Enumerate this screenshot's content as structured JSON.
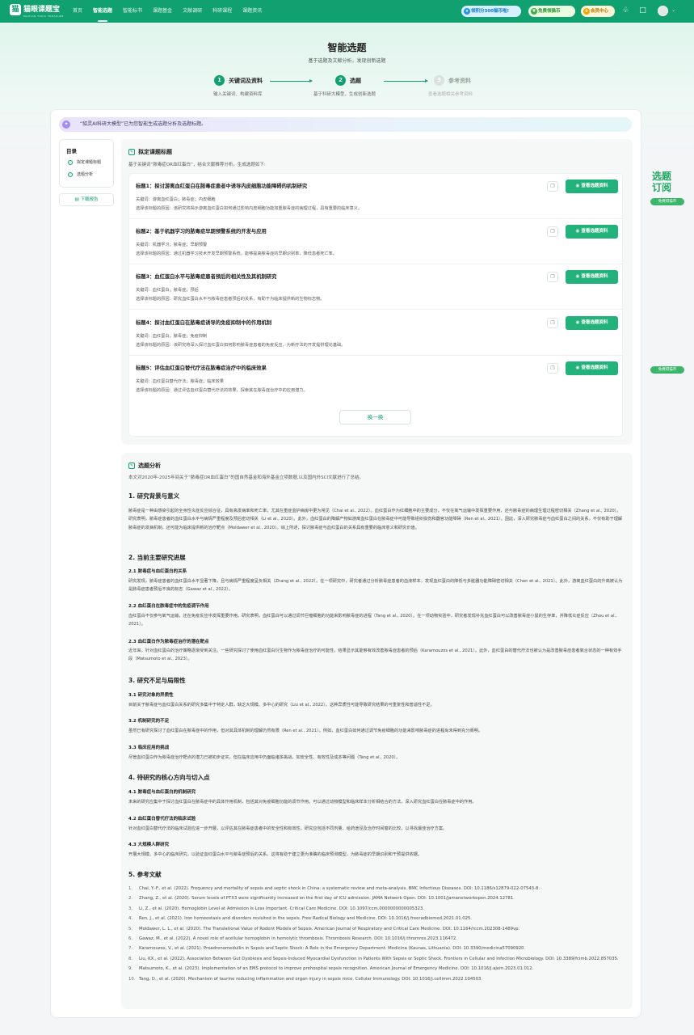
{
  "nav": {
    "logo_text": "猫眼课题宝",
    "logo_sub": "MAOYAN TOPIC TREASURE",
    "menu": [
      "首页",
      "智能选题",
      "智能标书",
      "课题基金",
      "文献调研",
      "科研课程",
      "课题资讯"
    ],
    "active_index": 1,
    "promo_blue": "领积分300猫币啦!",
    "promo_green": "免费领猫币",
    "vip": "会员中心"
  },
  "hero": {
    "title": "智能选题",
    "subtitle": "基于选题及文献分析，发现创新选题"
  },
  "steps": [
    {
      "num": "1",
      "label": "关键词及资料",
      "desc": "输入关键词、构建资料库"
    },
    {
      "num": "2",
      "label": "选题",
      "desc": "基于科研大模型，生成创新选题"
    },
    {
      "num": "3",
      "label": "参考资料",
      "desc": "查看选题相关参考资料"
    }
  ],
  "banner": "“貂灵AI科研大模型”已为您智能生成选题分析及选题标题。",
  "toc": {
    "title": "目录",
    "items": [
      "拟定课题标题",
      "选题分析"
    ],
    "download": "下载报告"
  },
  "titles_section": {
    "title": "拟定课题标题",
    "subtitle": "基于关键词“脓毒症OR血红蛋白”，结合文献推荐分析，生成选题如下:",
    "view_label": "查看选题资料",
    "swap_label": "换一换",
    "items": [
      {
        "title": "标题1：探讨游离血红蛋白在脓毒症患者中诱导内皮细胞功能障碍的机制研究",
        "keywords": "关键词：游离血红蛋白；脓毒症；内皮细胞",
        "reason": "选择该标题的原因：该研究将揭示游离血红蛋白如何通过影响内皮细胞功能加重脓毒症的病理过程，具有重要的临床意义。"
      },
      {
        "title": "标题2：基于机器学习的脓毒症早期预警系统的开发与应用",
        "keywords": "关键词：机器学习；脓毒症；早期预警",
        "reason": "选择该标题的原因：通过机器学习技术开发早期预警系统，能够提高脓毒症的早期识别率，降低患者死亡率。"
      },
      {
        "title": "标题3：血红蛋白水平与脓毒症患者预后的相关性及其机制研究",
        "keywords": "关键词：血红蛋白；脓毒症；预后",
        "reason": "选择该标题的原因：研究血红蛋白水平与脓毒症患者预后的关系，有助于为临床提供新的生物标志物。"
      },
      {
        "title": "标题4：探讨血红蛋白在脓毒症诱导的免疫抑制中的作用机制",
        "keywords": "关键词：血红蛋白；脓毒症；免疫抑制",
        "reason": "选择该标题的原因：该研究将深入探讨血红蛋白如何影响脓毒症患者的免疫反应，为新疗法的开发提供理论基础。"
      },
      {
        "title": "标题5：评估血红蛋白替代疗法在脓毒症治疗中的临床效果",
        "keywords": "关键词：血红蛋白替代疗法；脓毒症；临床效果",
        "reason": "选择该标题的原因：通过评估血红蛋白替代疗法的效果，探索其在脓毒症治疗中的应用潜力。"
      }
    ]
  },
  "float": {
    "title_line1": "选题",
    "title_line2": "订阅",
    "pill1": "免费得猫币",
    "pill2": "免费得猫币"
  },
  "analysis": {
    "title": "选题分析",
    "intro": "本文对2020年-2025年间关于“脓毒症OR血红蛋白”的国自然基金和海外基金立项数据,以及国内外SCI文献进行了总结。",
    "s1": {
      "title": "1. 研究背景与意义",
      "para": "脓毒症是一种由感染引起的全身性炎症反应综合征，具有高发病率和死亡率，尤其在重症监护病房中更为常见（Chai et al., 2022）。血红蛋白作为红细胞中的主要成分，不仅在氧气运输中发挥重要作用，还与脓毒症的病理生理过程密切相关（Zhang et al., 2020）。研究表明，脓毒症患者的血红蛋白水平与病情严重程度及预后密切相关（Li et al., 2020）。此外，血红蛋白的降解产物如游离血红蛋白在脓毒症中可能导致组织损伤和器官功能障碍（Ren et al., 2021）。因此，深入研究脓毒症与血红蛋白之间的关系，不仅有助于理解脓毒症的发病机制，还可能为临床提供新的治疗靶点（Moldawer et al., 2020）。综上所述，探讨脓毒症与血红蛋白的关系具有重要的临床意义和研究价值。"
    },
    "s2": {
      "title": "2. 当前主要研究进展",
      "sub1_title": "2.1 脓毒症与血红蛋白的关系",
      "sub1_para": "研究发现，脓毒症患者的血红蛋白水平显著下降，且与病情严重程度呈负相关（Zhang et al., 2022）。在一项研究中，研究者通过分析脓毒症患者的血液样本，发现血红蛋白的降低与多脏器功能障碍密切相关（Chen et al., 2021）。此外，游离血红蛋白的升高被认为是脓毒症患者预后不良的标志（Gawaz et al., 2022）。",
      "sub2_title": "2.2 血红蛋白在脓毒症中的免疫调节作用",
      "sub2_para": "血红蛋白不仅参与氧气运输，还在免疫反应中发挥重要作用。研究表明，血红蛋白可以通过调节巨噬细胞的功能来影响脓毒症的进程（Tang et al., 2020）。在一项动物实验中，研究者发现补充血红蛋白可以改善脓毒症小鼠的生存率，并降低炎症反应（Zhou et al., 2021）。",
      "sub3_title": "2.3 血红蛋白作为脓毒症治疗的潜在靶点",
      "sub3_para": "近年来，针对血红蛋白的治疗策略逐渐受到关注。一些研究探讨了使用血红蛋白衍生物作为脓毒症治疗的可能性，结果显示其能够有效改善脓毒症患者的预后（Karamouzos et al., 2021）。此外，血红蛋白的替代疗法也被认为是改善脓毒症患者氧合状态的一种有效手段（Matsumoto et al., 2023）。"
    },
    "s3": {
      "title": "3. 研究不足与局限性",
      "sub1_title": "3.1 研究对象的异质性",
      "sub1_para": "目前关于脓毒症与血红蛋白关系的研究多集中于特定人群，缺乏大规模、多中心的研究（Liu et al., 2022）。这种异质性可能导致研究结果的可重复性和普适性不足。",
      "sub2_title": "3.2 机制研究的不足",
      "sub2_para": "虽然已有研究探讨了血红蛋白在脓毒症中的作用，但对其具体机制的理解仍然有限（Ren et al., 2021）。例如，血红蛋白如何通过调节免疫细胞的功能来影响脓毒症的进程尚未得到充分阐明。",
      "sub3_title": "3.3 临床应用的挑战",
      "sub3_para": "尽管血红蛋白作为脓毒症治疗靶点的潜力已被初步证实，但在临床应用中仍面临诸多挑战，如安全性、有效性及成本等问题（Tang et al., 2020）。"
    },
    "s4": {
      "title": "4. 待研究的核心方向与切入点",
      "sub1_title": "4.1 脓毒症与血红蛋白的机制研究",
      "sub1_para": "未来的研究应集中于探讨血红蛋白在脓毒症中的具体作用机制，包括其对免疫细胞功能的调节作用。可以通过动物模型和临床样本分析相结合的方法，深入研究血红蛋白在脓毒症中的作用。",
      "sub2_title": "4.2 血红蛋白替代疗法的临床试验",
      "sub2_para": "针对血红蛋白替代疗法的临床试验应进一步开展，以评估其在脓毒症患者中的安全性和有效性。研究应包括不同剂量、给药途径及治疗时间窗的比较，以寻找最佳治疗方案。",
      "sub3_title": "4.3 大规模人群研究",
      "sub3_para": "开展大规模、多中心的临床研究，以验证血红蛋白水平与脓毒症预后的关系。这将有助于建立更为准确的临床预测模型，为脓毒症的早期识别和干预提供依据。"
    },
    "s5": {
      "title": "5. 参考文献",
      "refs": [
        "Chai, Y.-F., et al. (2022). Frequency and mortality of sepsis and septic shock in China: a systematic review and meta-analysis. BMC Infectious Diseases. DOI: 10.1186/s12879-022-07543-8.",
        "Zhang, Z., et al. (2020). Serum levels of PTX3 were significantly increased on the first day of ICU admission. JAMA Network Open. DOI: 10.1001/jamanetworkopen.2024.12781.",
        "Li, Z., et al. (2020). Hemoglobin Level at Admission Is Less Important. Critical Care Medicine. DOI: 10.1097/ccm.0000000000005323.",
        "Ren, J., et al. (2021). Iron homeostasis and disorders revisited in the sepsis. Free Radical Biology and Medicine. DOI: 10.1016/j.freeradbiomed.2021.01.025.",
        "Moldawer, L. L., et al. (2020). The Translational Value of Rodent Models of Sepsis. American Journal of Respiratory and Critical Care Medicine. DOI: 10.1164/rccm.202308-1489vp.",
        "Gawaz, M., et al. (2022). A novel role of acellular hemoglobin in hemolytic thrombosis. Thrombosis Research. DOI: 10.1016/j.thromres.2023.116472.",
        "Karamouzos, V., et al. (2021). Proadrenomedullin in Sepsis and Septic Shock: A Role in the Emergency Department. Medicina (Kaunas, Lithuania). DOI: 10.3390/medicina57090920.",
        "Liu, KX., et al. (2022). Association Between Gut Dysbiosis and Sepsis-Induced Myocardial Dysfunction in Patients With Sepsis or Septic Shock. Frontiers in Cellular and Infection Microbiology. DOI: 10.3389/fcimb.2022.857035.",
        "Matsumoto, K., et al. (2023). Implementation of an EMS protocol to improve prehospital sepsis recognition. American Journal of Emergency Medicine. DOI: 10.1016/j.ajem.2023.01.012.",
        "Tang, D., et al. (2020). Mechanism of taurine reducing inflammation and organ injury in sepsis mice. Cellular Immunology. DOI: 10.1016/j.cellimm.2022.104503."
      ]
    }
  }
}
